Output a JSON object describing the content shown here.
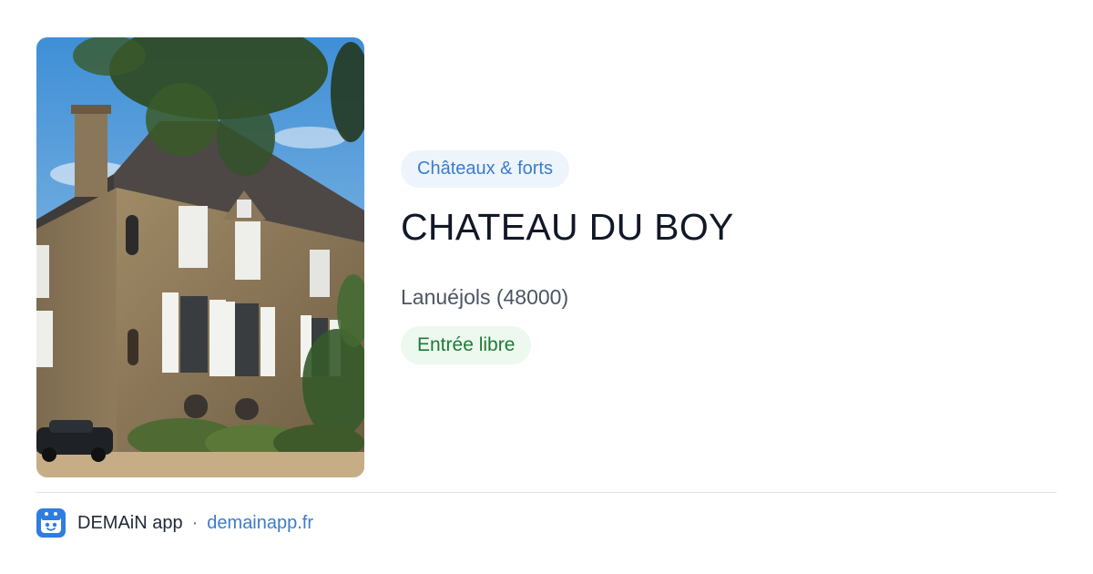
{
  "place": {
    "category": "Châteaux & forts",
    "name": "CHATEAU DU BOY",
    "location": "Lanuéjols (48000)",
    "entry": "Entrée libre"
  },
  "footer": {
    "app_name": "DEMAiN app",
    "separator": "·",
    "link": "demainapp.fr",
    "logo_icon": "demain-app-logo-icon"
  },
  "colors": {
    "category_chip_bg": "#eef4fc",
    "category_chip_text": "#3c7ccc",
    "entry_chip_bg": "#edf8ef",
    "entry_chip_text": "#1f7a37",
    "title_text": "#111827",
    "link": "#3c7ccc"
  }
}
